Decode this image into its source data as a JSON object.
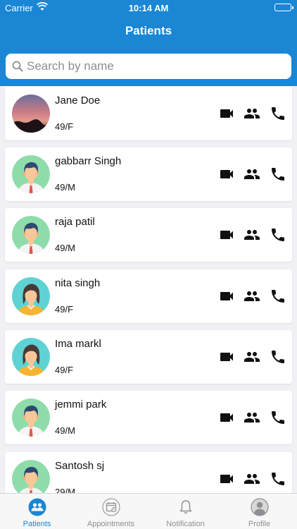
{
  "status_bar": {
    "carrier": "Carrier",
    "time": "10:14 AM"
  },
  "nav": {
    "title": "Patients"
  },
  "search": {
    "placeholder": "Search by name",
    "value": ""
  },
  "patients": [
    {
      "name": "Jane Doe",
      "age_gender": "49/F",
      "avatar": "sunset-photo"
    },
    {
      "name": "gabbarr Singh",
      "age_gender": "49/M",
      "avatar": "male-avatar"
    },
    {
      "name": "raja patil",
      "age_gender": "49/M",
      "avatar": "male-avatar"
    },
    {
      "name": "nita singh",
      "age_gender": "49/F",
      "avatar": "female-avatar"
    },
    {
      "name": "Ima markl",
      "age_gender": "49/F",
      "avatar": "female-avatar"
    },
    {
      "name": "jemmi park",
      "age_gender": "49/M",
      "avatar": "male-avatar"
    },
    {
      "name": "Santosh sj",
      "age_gender": "29/M",
      "avatar": "male-avatar"
    }
  ],
  "tabs": [
    {
      "label": "Patients",
      "icon": "patients-icon",
      "active": true
    },
    {
      "label": "Appointments",
      "icon": "calendar-icon",
      "active": false
    },
    {
      "label": "Notification",
      "icon": "bell-icon",
      "active": false
    },
    {
      "label": "Profile",
      "icon": "profile-icon",
      "active": false
    }
  ],
  "colors": {
    "primary": "#1a86d4",
    "background": "#f0f0f5",
    "inactive_tab": "#8e8e93"
  }
}
